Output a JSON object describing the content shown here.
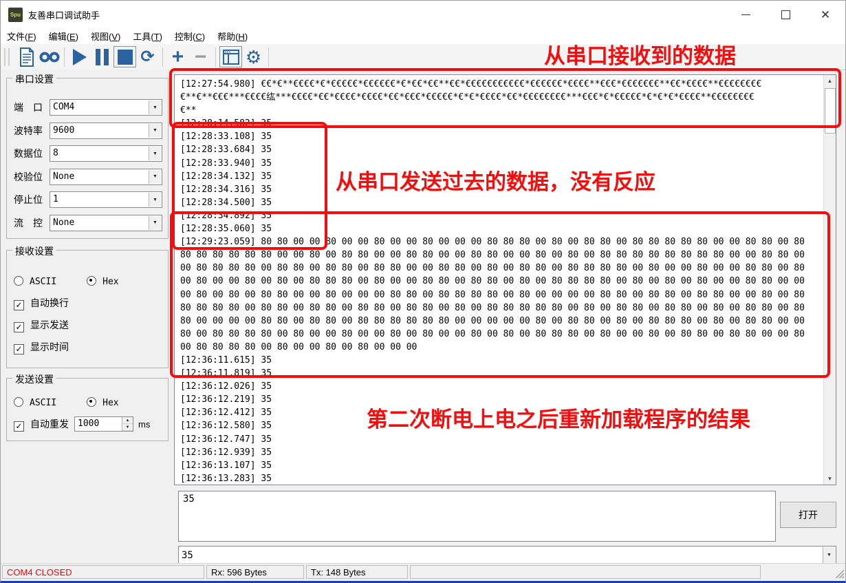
{
  "window": {
    "title": "友善串口调试助手",
    "app_icon_text": "Spu"
  },
  "menu": {
    "items": [
      {
        "text": "文件",
        "key": "F"
      },
      {
        "text": "编辑",
        "key": "E"
      },
      {
        "text": "视图",
        "key": "V"
      },
      {
        "text": "工具",
        "key": "T"
      },
      {
        "text": "控制",
        "key": "C"
      },
      {
        "text": "帮助",
        "key": "H"
      }
    ]
  },
  "toolbar": {
    "icons": [
      "new-file-icon",
      "record-icon",
      "play-icon",
      "pause-icon",
      "stop-icon",
      "refresh-icon",
      "zoom-in-icon",
      "zoom-out-icon",
      "window-panel-icon",
      "settings-gear-icon"
    ],
    "accent_color": "#2a63a0"
  },
  "serial_settings": {
    "group_title": "串口设置",
    "fields": [
      {
        "name": "port",
        "label": "端　口",
        "value": "COM4"
      },
      {
        "name": "baudrate",
        "label": "波特率",
        "value": "9600"
      },
      {
        "name": "databits",
        "label": "数据位",
        "value": "8"
      },
      {
        "name": "parity",
        "label": "校验位",
        "value": "None"
      },
      {
        "name": "stopbits",
        "label": "停止位",
        "value": "1"
      },
      {
        "name": "flowctrl",
        "label": "流　控",
        "value": "None"
      }
    ]
  },
  "receive_settings": {
    "group_title": "接收设置",
    "radio_ascii": "ASCII",
    "radio_hex": "Hex",
    "hex_selected": true,
    "checkboxes": [
      {
        "name": "auto-newline",
        "label": "自动换行",
        "checked": true
      },
      {
        "name": "show-send",
        "label": "显示发送",
        "checked": true
      },
      {
        "name": "show-time",
        "label": "显示时间",
        "checked": true
      }
    ]
  },
  "send_settings": {
    "group_title": "发送设置",
    "radio_ascii": "ASCII",
    "radio_hex": "Hex",
    "hex_selected": true,
    "auto_resend_label": "自动重发",
    "auto_resend_checked": true,
    "auto_resend_value": "1000",
    "auto_resend_unit": "ms"
  },
  "terminal": {
    "lines": [
      "[12:27:54.980] €€*€**€€€€*€*€€€€€*€€€€€€*€*€€*€€**€€*€€€€€€€€€€€*€€€€€€*€€€€**€€€*€€€€€€€**€€*€€€€**€€€€€€€€",
      "€**€**€€€***€€€€纮***€€€€*€€*€€€€*€€€€*€€*€€€*€€€€€*€*€*€€€€*€€*€€€€€€€€***€€€*€*€€€€€*€*€*€*€€€€**€€€€€€€€",
      "€**",
      "[12:28:14.582] 35",
      "[12:28:33.108] 35",
      "[12:28:33.684] 35",
      "[12:28:33.940] 35",
      "[12:28:34.132] 35",
      "[12:28:34.316] 35",
      "[12:28:34.500] 35",
      "[12:28:34.892] 35",
      "[12:28:35.060] 35",
      "[12:29:23.059] 80 80 00 00 80 00 00 80 00 00 80 00 00 00 80 80 80 00 80 00 80 80 00 80 80 80 80 80 00 00 80 80 00 80",
      "80 80 80 80 80 80 00 00 80 00 80 80 00 00 80 80 00 00 80 80 00 00 80 00 80 00 80 80 80 80 80 80 80 80 00 00 80 80 00",
      "00 80 80 80 80 00 80 80 00 80 80 00 80 80 00 00 80 80 00 80 00 80 80 00 80 80 80 80 00 80 00 00 80 00 00 80 80 00 80",
      "00 80 00 00 80 00 80 00 80 80 80 00 80 00 00 80 80 00 80 80 00 80 00 80 80 80 80 00 80 00 80 00 80 00 00 80 80 00 00",
      "00 80 00 80 00 80 80 00 00 80 00 00 00 80 80 00 80 80 80 80 00 80 00 00 00 00 80 80 00 80 80 00 80 80 00 00 80 00 80",
      "80 80 80 80 00 80 80 00 80 80 00 80 80 00 80 80 00 80 00 80 80 80 80 80 00 80 00 80 80 00 80 80 00 80 00 80 80 00 80",
      "80 00 00 00 00 80 80 00 80 80 00 80 80 80 80 80 80 00 00 00 00 00 80 00 80 80 00 80 00 80 80 80 00 80 00 80 80 00 00",
      "80 00 80 80 80 80 00 80 00 00 80 00 00 80 00 80 00 00 80 00 80 00 80 80 80 00 80 00 00 80 00 80 80 00 80 80 00 00 80",
      "00 80 80 80 80 00 80 00 00 80 00 80 00 00 00",
      "[12:36:11.615] 35",
      "[12:36:11.819] 35",
      "[12:36:12.026] 35",
      "[12:36:12.219] 35",
      "[12:36:12.412] 35",
      "[12:36:12.580] 35",
      "[12:36:12.747] 35",
      "[12:36:12.939] 35",
      "[12:36:13.107] 35",
      "[12:36:13.283] 35"
    ]
  },
  "send_area": {
    "textarea_value": "35",
    "open_button": "打开",
    "combo_value": "35"
  },
  "status_bar": {
    "status": "COM4 CLOSED",
    "status_color": "#ff0000",
    "rx": "Rx: 596 Bytes",
    "tx": "Tx: 148 Bytes"
  },
  "annotations": {
    "color": "#f30d0d",
    "received_label": "从串口接收到的数据",
    "sent_label": "从串口发送过去的数据，没有反应",
    "reload_label": "第二次断电上电之后重新加载程序的结果"
  }
}
